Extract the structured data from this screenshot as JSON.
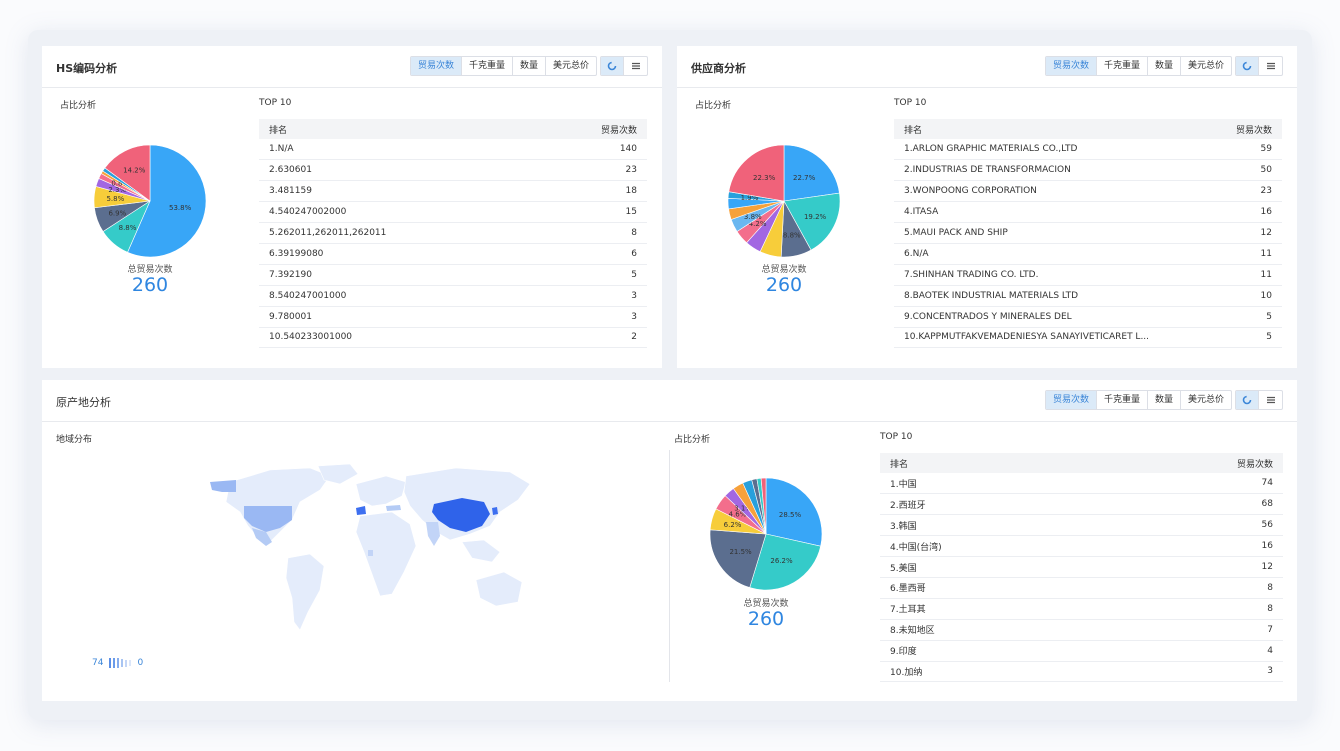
{
  "hs_panel": {
    "title": "HS编码分析",
    "tabs": [
      "贸易次数",
      "千克重量",
      "数量",
      "美元总价"
    ],
    "active_tab": 0,
    "pie_label": "占比分析",
    "top_label": "TOP 10",
    "total_label": "总贸易次数",
    "total_value": "260",
    "table_headers": [
      "排名",
      "贸易次数"
    ],
    "rows": [
      {
        "name": "1.N/A",
        "value": "140"
      },
      {
        "name": "2.630601",
        "value": "23"
      },
      {
        "name": "3.481159",
        "value": "18"
      },
      {
        "name": "4.540247002000",
        "value": "15"
      },
      {
        "name": "5.262011,262011,262011",
        "value": "8"
      },
      {
        "name": "6.39199080",
        "value": "6"
      },
      {
        "name": "7.392190",
        "value": "5"
      },
      {
        "name": "8.540247001000",
        "value": "3"
      },
      {
        "name": "9.780001",
        "value": "3"
      },
      {
        "name": "10.540233001000",
        "value": "2"
      }
    ]
  },
  "supplier_panel": {
    "title": "供应商分析",
    "tabs": [
      "贸易次数",
      "千克重量",
      "数量",
      "美元总价"
    ],
    "active_tab": 0,
    "pie_label": "占比分析",
    "top_label": "TOP 10",
    "total_label": "总贸易次数",
    "total_value": "260",
    "table_headers": [
      "排名",
      "贸易次数"
    ],
    "rows": [
      {
        "name": "1.ARLON GRAPHIC MATERIALS CO.,LTD",
        "value": "59"
      },
      {
        "name": "2.INDUSTRIAS DE TRANSFORMACION",
        "value": "50"
      },
      {
        "name": "3.WONPOONG CORPORATION",
        "value": "23"
      },
      {
        "name": "4.ITASA",
        "value": "16"
      },
      {
        "name": "5.MAUI PACK AND SHIP",
        "value": "12"
      },
      {
        "name": "6.N/A",
        "value": "11"
      },
      {
        "name": "7.SHINHAN TRADING CO. LTD.",
        "value": "11"
      },
      {
        "name": "8.BAOTEK INDUSTRIAL MATERIALS LTD",
        "value": "10"
      },
      {
        "name": "9.CONCENTRADOS Y MINERALES DEL",
        "value": "5"
      },
      {
        "name": "10.KAPPMUTFAKVEMADENIESYA SANAYIVETICARET L...",
        "value": "5"
      }
    ]
  },
  "origin_panel": {
    "title": "原产地分析",
    "tabs": [
      "贸易次数",
      "千克重量",
      "数量",
      "美元总价"
    ],
    "active_tab": 0,
    "map_label": "地域分布",
    "legend_max": "74",
    "legend_min": "0",
    "pie_label": "占比分析",
    "top_label": "TOP 10",
    "total_label": "总贸易次数",
    "total_value": "260",
    "table_headers": [
      "排名",
      "贸易次数"
    ],
    "rows": [
      {
        "name": "1.中国",
        "value": "74"
      },
      {
        "name": "2.西班牙",
        "value": "68"
      },
      {
        "name": "3.韩国",
        "value": "56"
      },
      {
        "name": "4.中国(台湾)",
        "value": "16"
      },
      {
        "name": "5.美国",
        "value": "12"
      },
      {
        "name": "6.墨西哥",
        "value": "8"
      },
      {
        "name": "7.土耳其",
        "value": "8"
      },
      {
        "name": "8.未知地区",
        "value": "7"
      },
      {
        "name": "9.印度",
        "value": "4"
      },
      {
        "name": "10.加纳",
        "value": "3"
      }
    ]
  },
  "colors": {
    "accent": "#2f86e0",
    "active_tab_bg": "#dbeaf8"
  },
  "chart_data": [
    {
      "type": "pie",
      "values": [
        53.8,
        8.8,
        6.9,
        5.8,
        2.3,
        1.5,
        0.8,
        1.0,
        14.2
      ],
      "labels": [
        "53.8%",
        "8.8%",
        "6.9%",
        "5.8%",
        "2.3%",
        "",
        "0.8%",
        "",
        "14.2%"
      ],
      "colors": [
        "#38a6f7",
        "#35cbc9",
        "#5b6e8f",
        "#f7cd3a",
        "#a267e2",
        "#f36e8c",
        "#f6a13a",
        "#28a0dc",
        "#f0627a"
      ]
    },
    {
      "type": "pie",
      "values": [
        22.7,
        19.2,
        8.8,
        6.2,
        4.6,
        4.2,
        3.8,
        3.1,
        3.0,
        1.9,
        22.3
      ],
      "labels": [
        "22.7%",
        "19.2%",
        "8.8%",
        "",
        "",
        "4.2%",
        "3.8%",
        "",
        "",
        "1.9%",
        "22.3%"
      ],
      "colors": [
        "#38a6f7",
        "#35cbc9",
        "#5b6e8f",
        "#f7cd3a",
        "#a267e2",
        "#f36e8c",
        "#6ab7f0",
        "#f6a13a",
        "#38a6f7",
        "#28a0dc",
        "#f0627a"
      ]
    },
    {
      "type": "pie",
      "values": [
        28.5,
        26.2,
        21.5,
        6.2,
        4.6,
        3.1,
        3.1,
        2.7,
        1.5,
        1.2,
        1.4
      ],
      "labels": [
        "28.5%",
        "26.2%",
        "21.5%",
        "6.2%",
        "4.6%",
        "3.1%",
        "",
        "",
        "",
        "",
        ""
      ],
      "colors": [
        "#38a6f7",
        "#35cbc9",
        "#5b6e8f",
        "#f7cd3a",
        "#f36e8c",
        "#a267e2",
        "#f6a13a",
        "#28a0dc",
        "#5b6e8f",
        "#35cbc9",
        "#f0627a"
      ]
    }
  ]
}
